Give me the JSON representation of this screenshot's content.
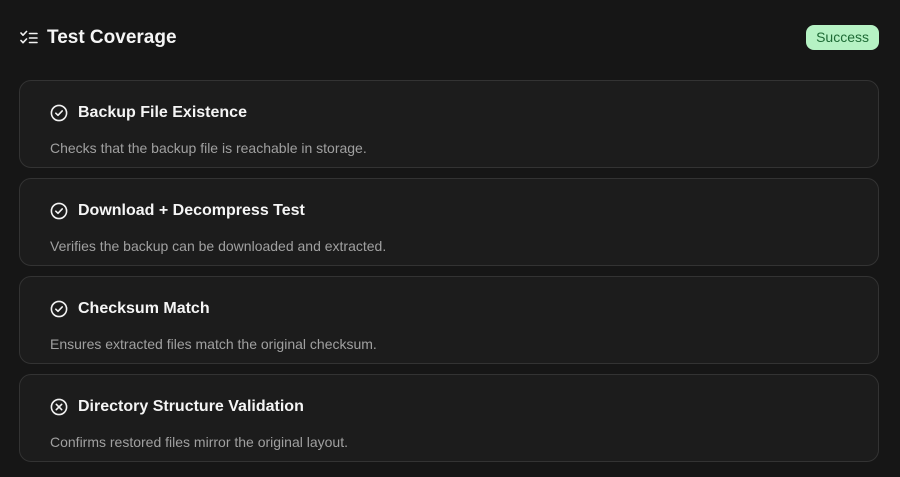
{
  "header": {
    "icon": "checklist-icon",
    "title": "Test Coverage",
    "status": "Success",
    "status_bg": "#b6f2c4",
    "status_fg": "#1e6b35"
  },
  "tests": [
    {
      "icon": "check-circle-icon",
      "title": "Backup File Existence",
      "description": "Checks that the backup file is reachable in storage."
    },
    {
      "icon": "check-circle-icon",
      "title": "Download + Decompress Test",
      "description": "Verifies the backup can be downloaded and extracted."
    },
    {
      "icon": "check-circle-icon",
      "title": "Checksum Match",
      "description": "Ensures extracted files match the original checksum."
    },
    {
      "icon": "x-circle-icon",
      "title": "Directory Structure Validation",
      "description": "Confirms restored files mirror the original layout."
    }
  ]
}
